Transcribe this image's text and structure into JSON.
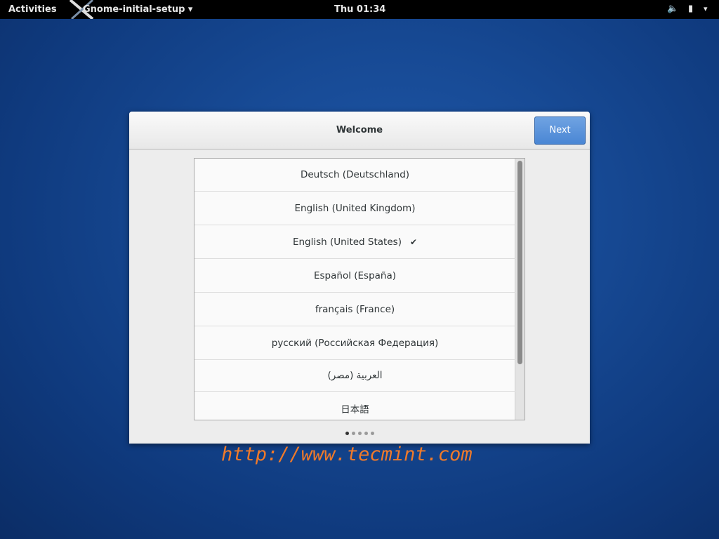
{
  "topbar": {
    "activities": "Activities",
    "app_menu": "Gnome-initial-setup ▾",
    "clock": "Thu 01:34",
    "volume_icon": "🔈",
    "battery_icon": "▮",
    "system_menu": "▾"
  },
  "dialog": {
    "title": "Welcome",
    "next_label": "Next",
    "languages": [
      {
        "label": "Deutsch (Deutschland)",
        "selected": false
      },
      {
        "label": "English (United Kingdom)",
        "selected": false
      },
      {
        "label": "English (United States)",
        "selected": true
      },
      {
        "label": "Español (España)",
        "selected": false
      },
      {
        "label": "français (France)",
        "selected": false
      },
      {
        "label": "русский (Российская Федерация)",
        "selected": false
      },
      {
        "label": "العربية (مصر)",
        "selected": false
      },
      {
        "label": "日本語",
        "selected": false
      }
    ],
    "check_mark": "✔",
    "pages": 5,
    "current_page": 1
  },
  "watermark": "http://www.tecmint.com"
}
